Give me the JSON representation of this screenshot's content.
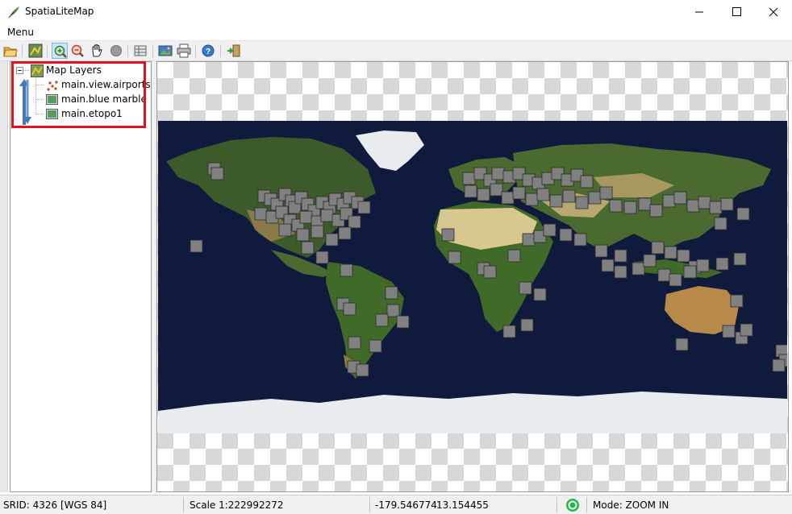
{
  "window": {
    "title": "SpatiaLiteMap",
    "controls": [
      "minimize-icon",
      "maximize-icon",
      "close-icon"
    ]
  },
  "menu": {
    "label": "Menu"
  },
  "toolbar": {
    "icons": [
      "open-folder-icon",
      "layer-config-icon",
      "zoom-in-icon",
      "zoom-out-icon",
      "pan-hand-icon",
      "identify-icon",
      "table-icon",
      "image-export-icon",
      "print-icon",
      "help-icon",
      "exit-icon"
    ],
    "active": "zoom-in-icon"
  },
  "layers": {
    "root_label": "Map Layers",
    "items": [
      {
        "label": "main.view.airports",
        "icon": "point-layer-icon"
      },
      {
        "label": "main.blue marble",
        "icon": "raster-layer-icon"
      },
      {
        "label": "main.etopo1",
        "icon": "raster-layer-icon"
      }
    ]
  },
  "map": {
    "ocean_color": "#0f1a3d",
    "land_color": "#3d5a2a",
    "ice_color": "#e8ecef",
    "marker_color": "#808080"
  },
  "status": {
    "srid": "SRID: 4326 [WGS 84]",
    "scale": "Scale 1:222992272",
    "lon": "-179.546774",
    "lat": "13.154455",
    "mode": "Mode: ZOOM IN"
  },
  "colors": {
    "highlight": "#e0121f",
    "toolbar_active": "#cce4f7"
  }
}
